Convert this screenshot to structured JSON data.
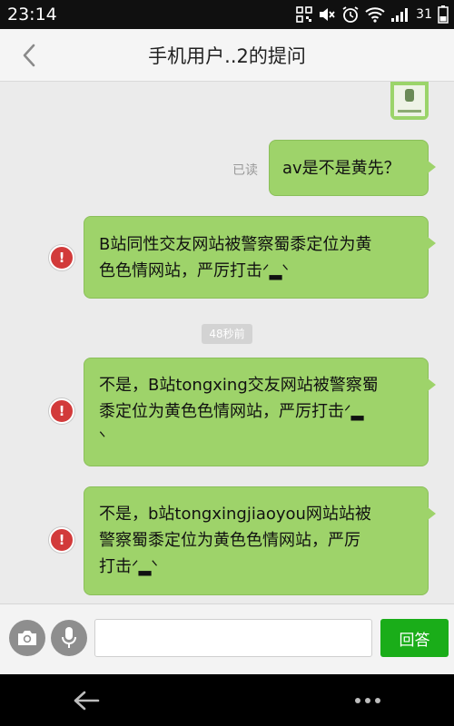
{
  "status_bar": {
    "time": "23:14",
    "battery_level": "31",
    "icons": [
      "qr-icon",
      "mute-icon",
      "alarm-icon",
      "wifi-icon",
      "signal-icon",
      "battery-icon"
    ]
  },
  "header": {
    "title": "手机用户..2的提问",
    "back_icon": "chevron-left-icon"
  },
  "chat": {
    "read_receipt": "已读",
    "timestamp": "48秒前",
    "messages": [
      {
        "text": "av是不是黄先？",
        "status": "read"
      },
      {
        "text": "B站同性交友网站被警察蜀黍定位为黄\n色色情网站，严厉打击ᐟ▂ᐠ",
        "status": "failed"
      },
      {
        "text": "不是，B站tongxing交友网站被警察蜀\n黍定位为黄色色情网站，严厉打击ᐟ▂\nᐠ",
        "status": "failed"
      },
      {
        "text": "不是，b站tongxingjiaoyou网站站被\n警察蜀黍定位为黄色色情网站，严厉\n打击ᐟ▂ᐠ",
        "status": "failed"
      }
    ]
  },
  "input_bar": {
    "camera_icon": "camera-icon",
    "voice_icon": "microphone-icon",
    "input_value": "",
    "send_label": "回答"
  },
  "nav_bar": {
    "back_icon": "arrow-left-icon",
    "menu_icon": "more-dots-icon"
  },
  "colors": {
    "bubble": "#9ed36a",
    "send_button": "#1aad19",
    "error": "#d23a3a"
  }
}
